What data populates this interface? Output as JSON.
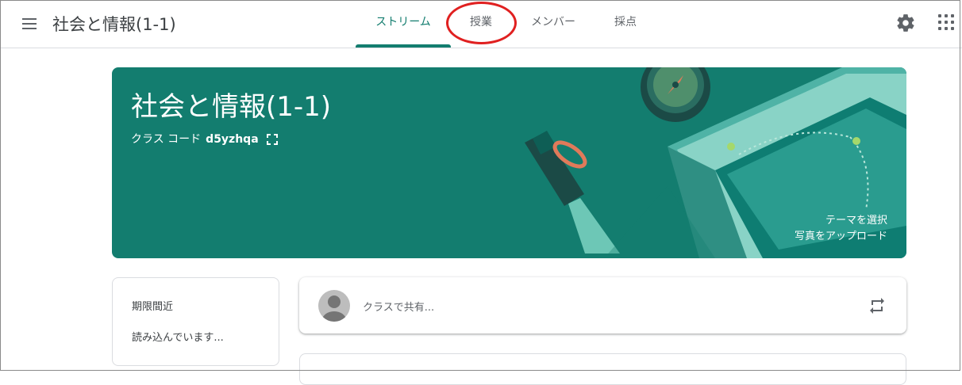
{
  "header": {
    "course_title": "社会と情報(1-1)",
    "tabs": [
      {
        "label": "ストリーム",
        "active": true
      },
      {
        "label": "授業",
        "active": false
      },
      {
        "label": "メンバー",
        "active": false
      },
      {
        "label": "採点",
        "active": false
      }
    ],
    "icons": [
      "menu-icon",
      "gear-icon",
      "apps-icon"
    ]
  },
  "banner": {
    "title": "社会と情報(1-1)",
    "class_code_label": "クラス コード",
    "class_code_value": "d5yzhqa",
    "select_theme": "テーマを選択",
    "upload_photo": "写真をアップロード",
    "color": "#137d6f"
  },
  "due_card": {
    "title": "期限間近",
    "loading_text": "読み込んでいます..."
  },
  "share": {
    "placeholder": "クラスで共有..."
  },
  "colors": {
    "accent": "#137d6f",
    "annotation": "#e02020"
  }
}
